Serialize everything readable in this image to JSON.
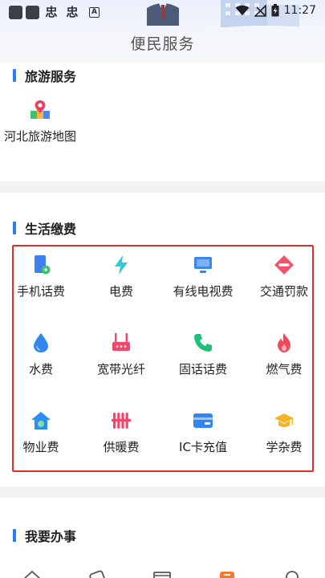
{
  "status_bar": {
    "icon_chars": [
      "忠",
      "忠"
    ],
    "small_badge": "A",
    "time": "11:27"
  },
  "header": {
    "title": "便民服务"
  },
  "sections": {
    "travel": {
      "title": "旅游服务",
      "items": [
        {
          "label": "河北旅游地图",
          "icon": "map-pin-icon"
        }
      ]
    },
    "life": {
      "title": "生活缴费",
      "items": [
        {
          "label": "手机话费",
          "icon": "mobile-phone-icon",
          "color": "#3f7ff0"
        },
        {
          "label": "电费",
          "icon": "lightning-icon",
          "color": "#2fcbd8"
        },
        {
          "label": "有线电视费",
          "icon": "tv-icon",
          "color": "#3a86f0"
        },
        {
          "label": "交通罚款",
          "icon": "traffic-fine-icon",
          "color": "#f2526a"
        },
        {
          "label": "水费",
          "icon": "water-drop-icon",
          "color": "#3186f2"
        },
        {
          "label": "宽带光纤",
          "icon": "router-icon",
          "color": "#f0476b"
        },
        {
          "label": "固话话费",
          "icon": "telephone-icon",
          "color": "#20c079"
        },
        {
          "label": "燃气费",
          "icon": "flame-icon",
          "color": "#f04a5c"
        },
        {
          "label": "物业费",
          "icon": "house-icon",
          "color": "#2f8cf2"
        },
        {
          "label": "供暖费",
          "icon": "radiator-icon",
          "color": "#f0476b"
        },
        {
          "label": "IC卡充值",
          "icon": "card-icon",
          "color": "#2f86f0"
        },
        {
          "label": "学杂费",
          "icon": "graduation-cap-icon",
          "color": "#f6b429"
        }
      ]
    },
    "work": {
      "title": "我要办事"
    }
  },
  "colors": {
    "accent": "#2b7de9",
    "highlight_frame": "#d9302b"
  }
}
